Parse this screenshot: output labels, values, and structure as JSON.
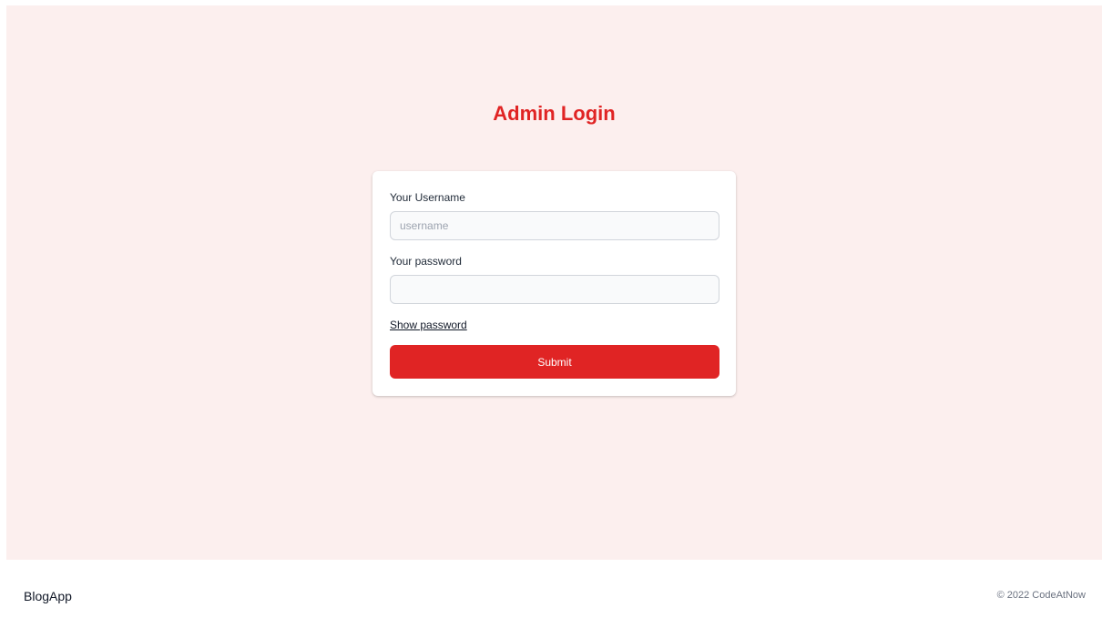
{
  "page": {
    "title": "Admin Login"
  },
  "login_form": {
    "username_label": "Your Username",
    "username_placeholder": "username",
    "username_value": "",
    "password_label": "Your password",
    "password_placeholder": "",
    "password_value": "",
    "show_password_label": "Show password",
    "submit_label": "Submit"
  },
  "footer": {
    "brand": "BlogApp",
    "copyright": "© 2022 CodeAtNow"
  },
  "colors": {
    "accent": "#e02424",
    "background": "#fcefee",
    "card": "#ffffff"
  }
}
